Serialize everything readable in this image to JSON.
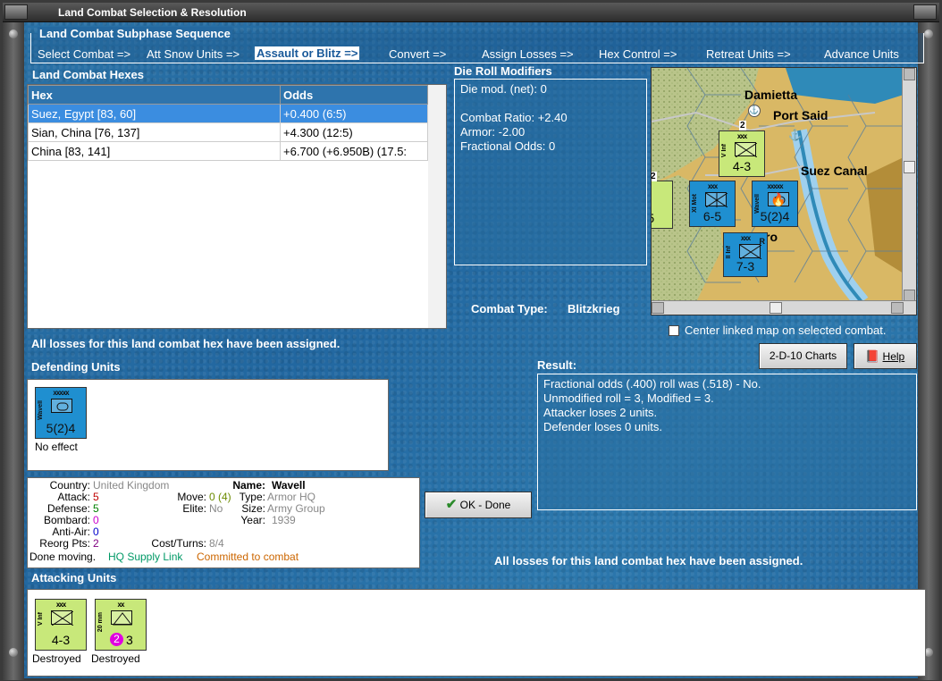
{
  "window": {
    "title": "Land Combat Selection & Resolution"
  },
  "sequence": {
    "title": "Land Combat Subphase Sequence",
    "steps": [
      "Select Combat =>",
      "Att Snow Units =>",
      "Assault or Blitz =>",
      "Convert =>",
      "Assign Losses =>",
      "Hex Control =>",
      "Retreat Units =>",
      "Advance Units"
    ],
    "active_index": 2
  },
  "hexes": {
    "title": "Land Combat Hexes",
    "columns": [
      "Hex",
      "Odds"
    ],
    "rows": [
      {
        "hex": "Suez, Egypt [83, 60]",
        "odds": "+0.400 (6:5)",
        "selected": true
      },
      {
        "hex": "Sian, China [76, 137]",
        "odds": "+4.300 (12:5)"
      },
      {
        "hex": "China [83, 141]",
        "odds": "+6.700 (+6.950B) (17.5:"
      }
    ]
  },
  "drm": {
    "title": "Die Roll Modifiers",
    "lines": [
      "Die mod. (net): 0",
      "",
      "Combat Ratio: +2.40",
      "Armor: -2.00",
      "Fractional Odds: 0"
    ]
  },
  "combat_type": {
    "label": "Combat Type:",
    "value": "Blitzkrieg"
  },
  "map": {
    "labels": [
      "Damietta",
      "Port Said",
      "Suez Canal",
      "ro"
    ],
    "counters": [
      {
        "side": "V Inf",
        "echelon": "xxx",
        "strength": "4-3",
        "color": "green",
        "stack": "2"
      },
      {
        "side": "XI Mot",
        "echelon": "xxx",
        "strength": "6-5",
        "color": "blue"
      },
      {
        "side": "Wavell",
        "echelon": "xxxxx",
        "strength": "5(2)4",
        "color": "blue"
      },
      {
        "side": "II Inf",
        "echelon": "xxx",
        "strength": "7-3",
        "color": "blue",
        "tag": "R"
      },
      {
        "side": "",
        "echelon": "",
        "strength": "-5",
        "color": "green",
        "stack": "2"
      }
    ]
  },
  "center_map": {
    "label": "Center linked map on selected combat.",
    "checked": false
  },
  "losses_msg_top": "All losses for this land combat hex have been assigned.",
  "losses_msg_bottom": "All losses for this land combat hex have been assigned.",
  "buttons": {
    "charts": "2-D-10 Charts",
    "help": "Help",
    "ok": "OK - Done"
  },
  "defending": {
    "title": "Defending Units",
    "units": [
      {
        "side": "Wavell",
        "echelon": "xxxxx",
        "strength": "5(2)4",
        "status": "No effect"
      }
    ]
  },
  "result": {
    "title": "Result:",
    "lines": [
      "Fractional odds (.400) roll was (.518)  - No.",
      "Unmodified roll = 3, Modified = 3.",
      "Attacker loses 2 units.",
      "Defender loses 0 units."
    ]
  },
  "unit_info": {
    "country_label": "Country:",
    "country": "United Kingdom",
    "attack_label": "Attack:",
    "attack": "5",
    "defense_label": "Defense:",
    "defense": "5",
    "bombard_label": "Bombard:",
    "bombard": "0",
    "antiair_label": "Anti-Air:",
    "antiair": "0",
    "reorg_label": "Reorg Pts:",
    "reorg": "2",
    "move_label": "Move:",
    "move": "0 (4)",
    "elite_label": "Elite:",
    "elite": "No",
    "cost_label": "Cost/Turns:",
    "cost": "8/4",
    "name_label": "Name:",
    "name": "Wavell",
    "type_label": "Type:",
    "type": "Armor HQ",
    "size_label": "Size:",
    "size": "Army Group",
    "year_label": "Year:",
    "year": "1939",
    "done_moving": "Done moving.",
    "supply": "HQ Supply Link",
    "committed": "Committed to combat"
  },
  "attacking": {
    "title": "Attacking Units",
    "units": [
      {
        "side": "V Inf",
        "echelon": "xxx",
        "strength": "4-3",
        "status": "Destroyed"
      },
      {
        "side": "20 mm",
        "echelon": "xx",
        "strength": "3",
        "badge": "2",
        "status": "Destroyed"
      }
    ]
  },
  "colors": {
    "accent": "#2e74ad",
    "selected_row": "#3b8de0",
    "attack": "#c00000",
    "defense": "#008000",
    "bombard": "#cc00cc",
    "antiair": "#0000cc",
    "reorg": "#800080",
    "supply": "#009966",
    "committed": "#cc6600",
    "counter_green": "#c8e87a",
    "counter_blue": "#1f8fd0"
  }
}
